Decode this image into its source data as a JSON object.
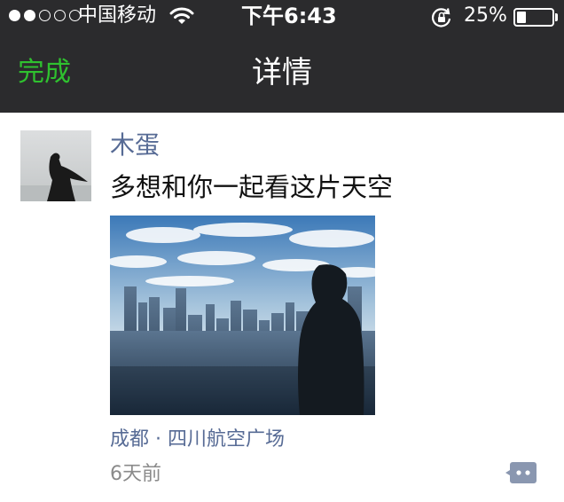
{
  "status_bar": {
    "carrier": "中国移动",
    "time": "下午6:43",
    "battery_percent": "25%",
    "battery_level": 0.25,
    "signal_strength": 2,
    "signal_max": 5
  },
  "nav": {
    "done_label": "完成",
    "title": "详情"
  },
  "post": {
    "username": "木蛋",
    "text": "多想和你一起看这片天空",
    "location": "成都 · 四川航空广场",
    "time_ago": "6天前"
  },
  "colors": {
    "bar_bg": "#2b2b2d",
    "done_green": "#2fc12f",
    "link_blue": "#576b95",
    "meta_gray": "#8a8a8a"
  },
  "icons": {
    "wifi": "wifi-icon",
    "rotation_lock": "rotation-lock-icon",
    "battery": "battery-icon",
    "comment": "comment-more-icon"
  }
}
